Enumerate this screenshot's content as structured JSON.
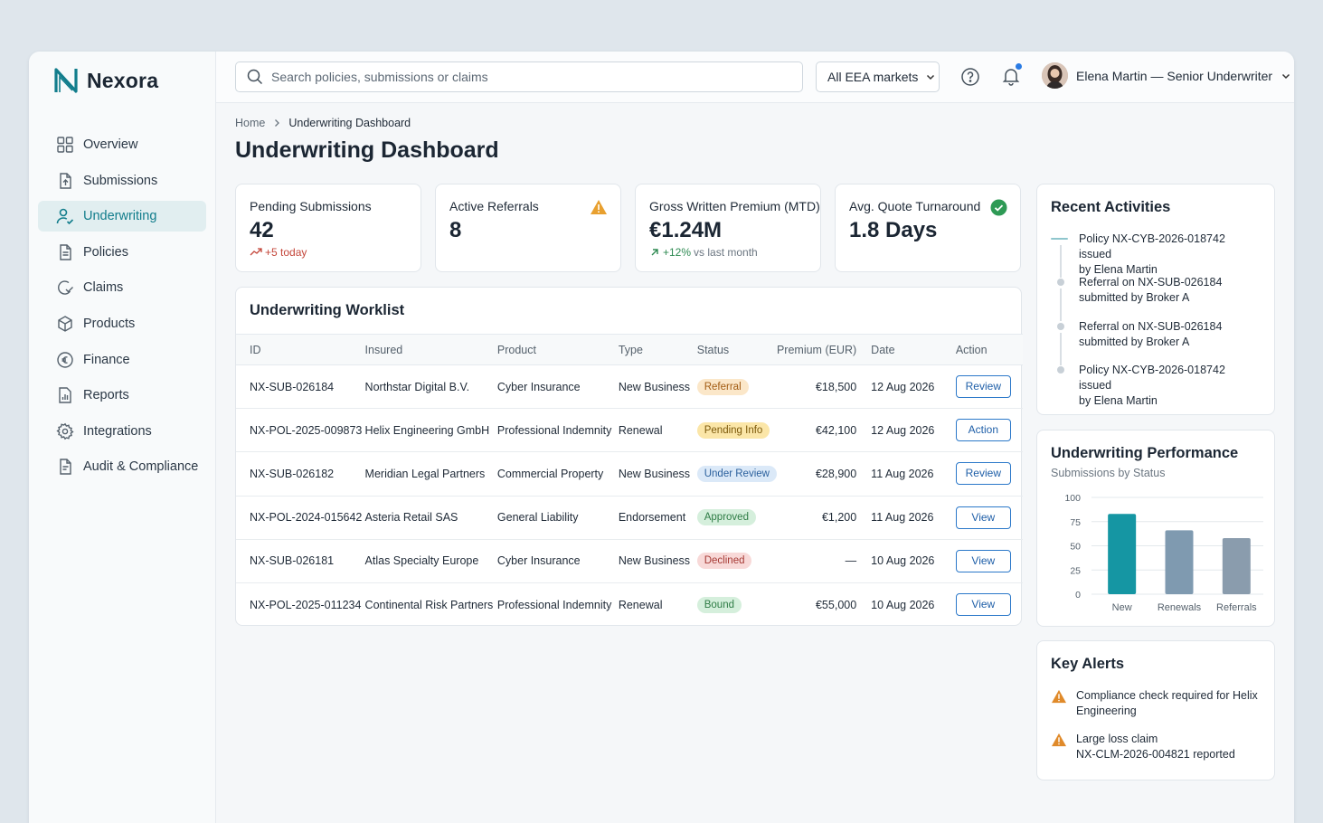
{
  "brand": {
    "name": "Nexora",
    "accent": "#127d8c"
  },
  "sidebar": {
    "items": [
      {
        "label": "Overview",
        "icon": "grid-icon"
      },
      {
        "label": "Submissions",
        "icon": "document-upload-icon"
      },
      {
        "label": "Underwriting",
        "icon": "user-check-icon",
        "active": true
      },
      {
        "label": "Policies",
        "icon": "document-icon"
      },
      {
        "label": "Claims",
        "icon": "claims-icon"
      },
      {
        "label": "Products",
        "icon": "cube-icon"
      },
      {
        "label": "Finance",
        "icon": "euro-coin-icon"
      },
      {
        "label": "Reports",
        "icon": "chart-document-icon"
      },
      {
        "label": "Integrations",
        "icon": "gear-icon"
      },
      {
        "label": "Audit & Compliance",
        "icon": "document-check-icon"
      }
    ]
  },
  "topbar": {
    "search_placeholder": "Search policies, submissions or claims",
    "market_select": "All EEA markets",
    "user_name": "Elena Martin — Senior Underwriter"
  },
  "breadcrumb": {
    "home": "Home",
    "current": "Underwriting Dashboard"
  },
  "page_title": "Underwriting Dashboard",
  "kpis": {
    "pending": {
      "label": "Pending Submissions",
      "value": "42",
      "delta": "+5 today"
    },
    "referrals": {
      "label": "Active Referrals",
      "value": "8"
    },
    "gwp": {
      "label": "Gross Written Premium (MTD)",
      "value": "€1.24M",
      "delta": "+12%",
      "delta_suffix": "vs last month"
    },
    "turnaround": {
      "label": "Avg. Quote Turnaround",
      "value": "1.8 Days"
    }
  },
  "worklist": {
    "title": "Underwriting Worklist",
    "columns": [
      "ID",
      "Insured",
      "Product",
      "Type",
      "Status",
      "Premium (EUR)",
      "Date",
      "Action"
    ],
    "rows": [
      {
        "id": "NX-SUB-026184",
        "insured": "Northstar Digital B.V.",
        "product": "Cyber Insurance",
        "type": "New Business",
        "status": "Referral",
        "premium": "€18,500",
        "date": "12 Aug 2026",
        "action": "Review"
      },
      {
        "id": "NX-POL-2025-009873",
        "insured": "Helix Engineering GmbH",
        "product": "Professional Indemnity",
        "type": "Renewal",
        "status": "Pending Info",
        "premium": "€42,100",
        "date": "12 Aug 2026",
        "action": "Action"
      },
      {
        "id": "NX-SUB-026182",
        "insured": "Meridian Legal Partners",
        "product": "Commercial Property",
        "type": "New Business",
        "status": "Under Review",
        "premium": "€28,900",
        "date": "11 Aug 2026",
        "action": "Review"
      },
      {
        "id": "NX-POL-2024-015642",
        "insured": "Asteria Retail SAS",
        "product": "General Liability",
        "type": "Endorsement",
        "status": "Approved",
        "premium": "€1,200",
        "date": "11 Aug 2026",
        "action": "View"
      },
      {
        "id": "NX-SUB-026181",
        "insured": "Atlas Specialty Europe",
        "product": "Cyber Insurance",
        "type": "New Business",
        "status": "Declined",
        "premium": "—",
        "date": "10 Aug 2026",
        "action": "View"
      },
      {
        "id": "NX-POL-2025-011234",
        "insured": "Continental Risk Partners",
        "product": "Professional Indemnity",
        "type": "Renewal",
        "status": "Bound",
        "premium": "€55,000",
        "date": "10 Aug 2026",
        "action": "View"
      }
    ]
  },
  "activities": {
    "title": "Recent Activities",
    "items": [
      {
        "line1": "Policy NX-CYB-2026-018742 issued",
        "line2": "by Elena Martin"
      },
      {
        "line1": "Referral on NX-SUB-026184",
        "line2": "submitted by Broker A"
      },
      {
        "line1": "Referral on NX-SUB-026184",
        "line2": "submitted by Broker A"
      },
      {
        "line1": "Policy NX-CYB-2026-018742 issued",
        "line2": "by Elena Martin"
      }
    ]
  },
  "performance": {
    "title": "Underwriting Performance",
    "subtitle": "Submissions by Status",
    "chart_data": {
      "type": "bar",
      "categories": [
        "New",
        "Renewals",
        "Referrals"
      ],
      "values": [
        83,
        66,
        58
      ],
      "ylim": [
        0,
        100
      ],
      "yticks": [
        0,
        25,
        50,
        75,
        100
      ],
      "colors": [
        "#1596a3",
        "#7f9ab0",
        "#8a9cad"
      ],
      "grid": true,
      "legend": "none"
    }
  },
  "alerts": {
    "title": "Key Alerts",
    "items": [
      {
        "line1": "Compliance check required for Helix",
        "line2": "Engineering"
      },
      {
        "line1": "Large loss claim",
        "line2": "NX-CLM-2026-004821 reported"
      }
    ]
  }
}
